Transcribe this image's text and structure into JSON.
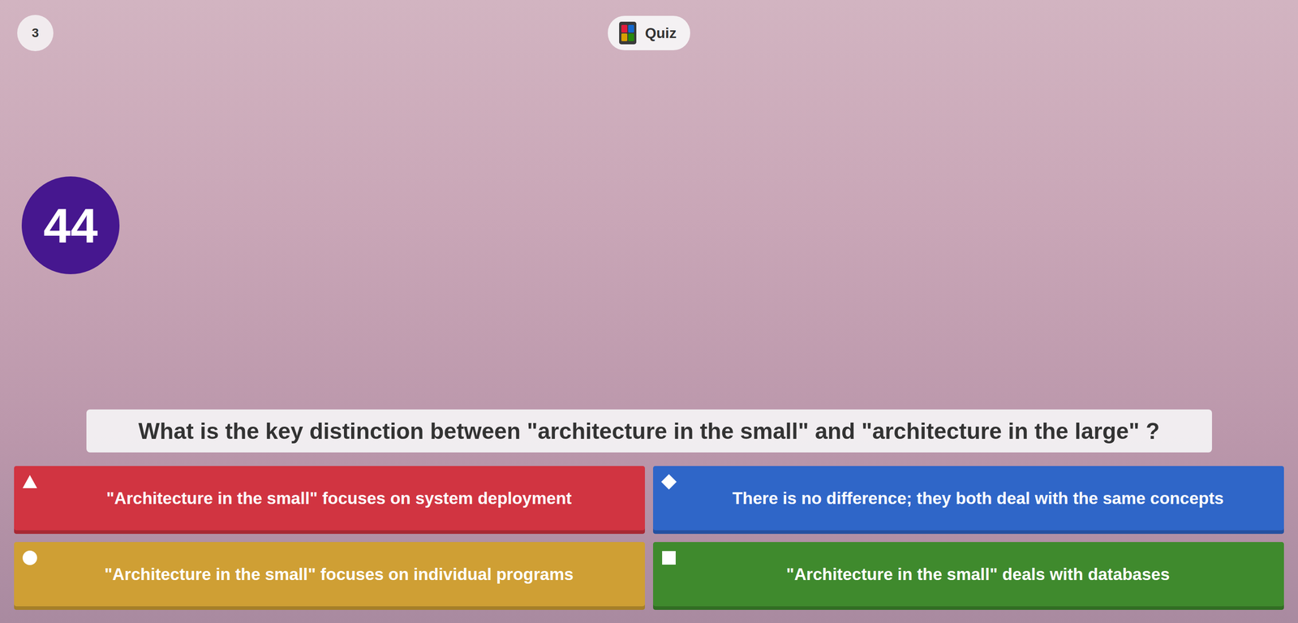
{
  "counter": "3",
  "header": {
    "title": "Quiz"
  },
  "timer": "44",
  "question": "What is the key distinction between \"architecture in the small\" and \"architecture in the large\" ?",
  "answers": [
    {
      "label": "\"Architecture in the small\" focuses on system deployment",
      "kind": "triangle",
      "color": "#d13441"
    },
    {
      "label": "There is no difference; they both deal with the same concepts",
      "kind": "diamond",
      "color": "#2f66c8"
    },
    {
      "label": "\"Architecture in the small\" focuses on individual programs",
      "kind": "circle",
      "color": "#cf9f34"
    },
    {
      "label": "\"Architecture in the small\" deals with databases",
      "kind": "square",
      "color": "#3f8a2d"
    }
  ]
}
